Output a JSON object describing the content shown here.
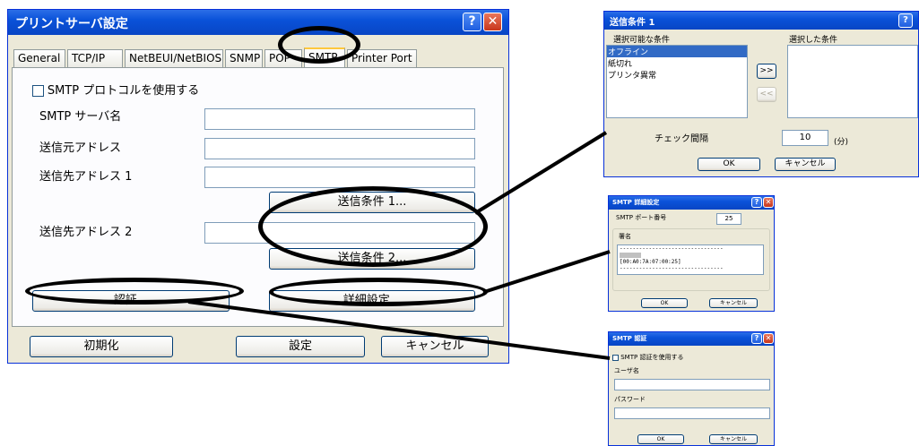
{
  "main": {
    "title": "プリントサーバ設定",
    "tabs": [
      "General",
      "TCP/IP",
      "NetBEUI/NetBIOS",
      "SNMP",
      "POP",
      "SMTP",
      "Printer Port"
    ],
    "smtp_checkbox": "SMTP プロトコルを使用する",
    "server_label": "SMTP サーバ名",
    "from_label": "送信元アドレス",
    "to1_label": "送信先アドレス 1",
    "cond1_button": "送信条件 1...",
    "to2_label": "送信先アドレス 2",
    "cond2_button": "送信条件 2...",
    "auth_button": "認証...",
    "detail_button": "詳細設定...",
    "init_button": "初期化",
    "set_button": "設定",
    "cancel_button": "キャンセル"
  },
  "cond_dialog": {
    "title": "送信条件 1",
    "available_label": "選択可能な条件",
    "selected_label": "選択した条件",
    "items": [
      "オフライン",
      "紙切れ",
      "プリンタ異常"
    ],
    "add_button": ">>",
    "remove_button": "<<",
    "interval_label": "チェック間隔",
    "interval_value": "10",
    "interval_unit": "(分)",
    "ok_button": "OK",
    "cancel_button": "キャンセル"
  },
  "detail_dialog": {
    "title": "SMTP 詳細設定",
    "port_label": "SMTP ポート番号",
    "port_value": "25",
    "signature_label": "署名",
    "sig_line1": "--------------------------------",
    "sig_line2": "[00:A0:7A:07:00:25]",
    "sig_line3": "--------------------------------",
    "ok_button": "OK",
    "cancel_button": "キャンセル"
  },
  "auth_dialog": {
    "title": "SMTP 認証",
    "use_auth": "SMTP 認証を使用する",
    "user_label": "ユーザ名",
    "password_label": "パスワード",
    "ok_button": "OK",
    "cancel_button": "キャンセル"
  }
}
